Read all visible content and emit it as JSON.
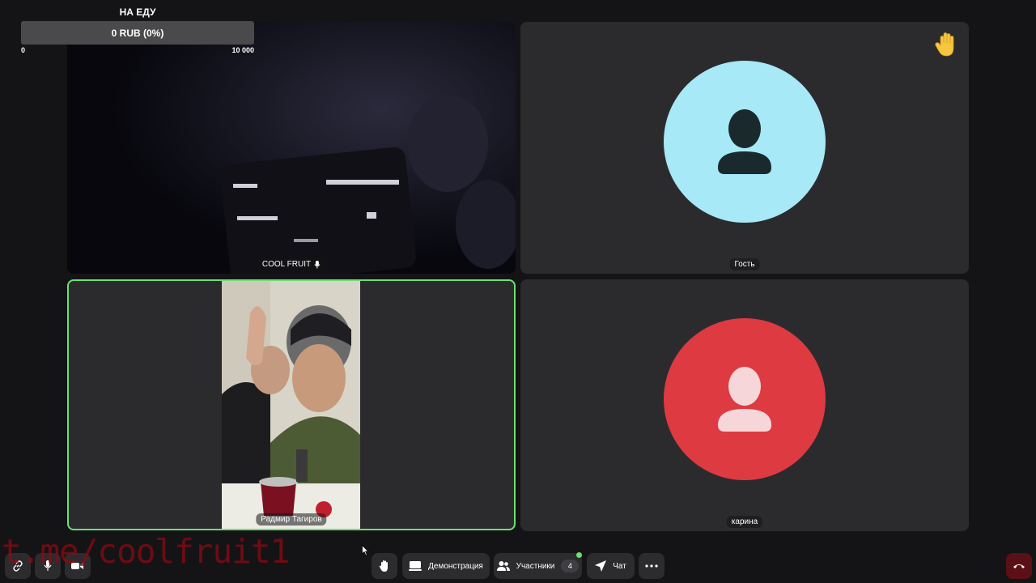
{
  "donation_goal": {
    "title": "НА ЕДУ",
    "progress_text": "0 RUB (0%)",
    "progress_fraction": 0.0,
    "min_label": "0",
    "max_label": "10 000"
  },
  "participants": [
    {
      "name": "COOL FRUIT",
      "state": "video",
      "mic_icon": "microphone-icon"
    },
    {
      "name": "Гость",
      "state": "avatar",
      "avatar_color": "#a7e9f6",
      "hand_raised": true
    },
    {
      "name": "Радмир Тагиров",
      "state": "video",
      "active_speaker": true
    },
    {
      "name": "карина",
      "state": "avatar",
      "avatar_color": "#de3a42"
    }
  ],
  "toolbar": {
    "raise_hand_icon": "hand-icon",
    "demo_label": "Демонстрация",
    "participants_label": "Участники",
    "participants_count": "4",
    "chat_label": "Чат",
    "more_icon": "more-icon",
    "end_call_icon": "hangup-icon"
  },
  "watermark": "t.me/coolfruit1",
  "colors": {
    "accent_green": "#6ce072",
    "end_call": "#5a1016",
    "tile_bg": "#2b2b2e"
  }
}
